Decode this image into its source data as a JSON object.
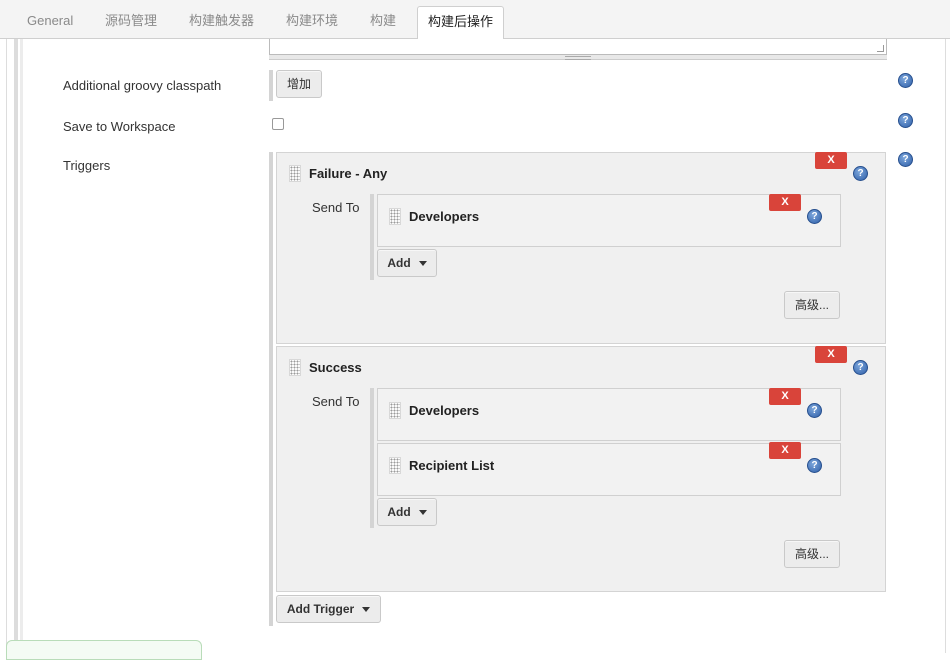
{
  "tabs": [
    "General",
    "源码管理",
    "构建触发器",
    "构建环境",
    "构建",
    "构建后操作"
  ],
  "active_tab": "构建后操作",
  "rows": {
    "groovy_classpath_label": "Additional groovy classpath",
    "groovy_add_button": "增加",
    "save_to_workspace_label": "Save to Workspace",
    "triggers_label": "Triggers"
  },
  "triggers": [
    {
      "title": "Failure - Any",
      "send_to_label": "Send To",
      "recipients": [
        "Developers"
      ],
      "add_label": "Add",
      "advanced_label": "高级..."
    },
    {
      "title": "Success",
      "send_to_label": "Send To",
      "recipients": [
        "Developers",
        "Recipient List"
      ],
      "add_label": "Add",
      "advanced_label": "高级..."
    }
  ],
  "delete_label": "X",
  "help_glyph": "?",
  "add_trigger_label": "Add Trigger",
  "colors": {
    "delete": "#d9443a",
    "help": "#2f5fa8"
  },
  "icons": [
    "help-icon",
    "drag-handle-icon",
    "dropdown-caret-icon"
  ]
}
